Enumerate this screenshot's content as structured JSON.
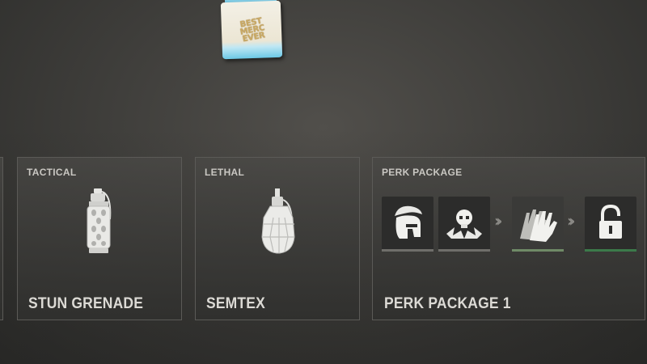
{
  "charm": {
    "text_line1": "BEST",
    "text_line2": "MERC",
    "text_line3": "EVER"
  },
  "loadout": {
    "tactical": {
      "category": "TACTICAL",
      "name": "STUN GRENADE",
      "icon": "stun-grenade-icon"
    },
    "lethal": {
      "category": "LETHAL",
      "name": "SEMTEX",
      "icon": "semtex-icon"
    },
    "perk_package": {
      "category": "PERK PACKAGE",
      "name": "PERK PACKAGE 1",
      "perks": [
        {
          "icon": "spartan-helmet-icon",
          "underline_color": "#6f6e6a"
        },
        {
          "icon": "skull-burst-icon",
          "underline_color": "#6f6e6a"
        },
        {
          "icon": "hands-icon",
          "underline_color": "#6f8a67"
        },
        {
          "icon": "padlock-icon",
          "underline_color": "#3c7a4a"
        }
      ]
    }
  },
  "colors": {
    "accent_green": "#3c7a4a",
    "card_border": "#5b5a57"
  }
}
